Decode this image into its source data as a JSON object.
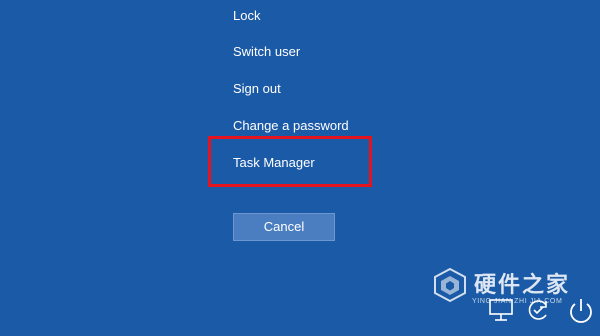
{
  "menu": {
    "items": [
      {
        "label": "Lock"
      },
      {
        "label": "Switch user"
      },
      {
        "label": "Sign out"
      },
      {
        "label": "Change a password"
      },
      {
        "label": "Task Manager"
      }
    ]
  },
  "cancel_label": "Cancel",
  "tray": {
    "icons": [
      "network-icon",
      "accessibility-icon",
      "power-icon"
    ]
  },
  "watermark": {
    "title": "硬件之家",
    "subtitle": "YING JIAN ZHI JIA.COM"
  },
  "colors": {
    "background": "#1b5aa6",
    "highlight": "#e5121f",
    "cancel_button": "#4a7ec0"
  }
}
